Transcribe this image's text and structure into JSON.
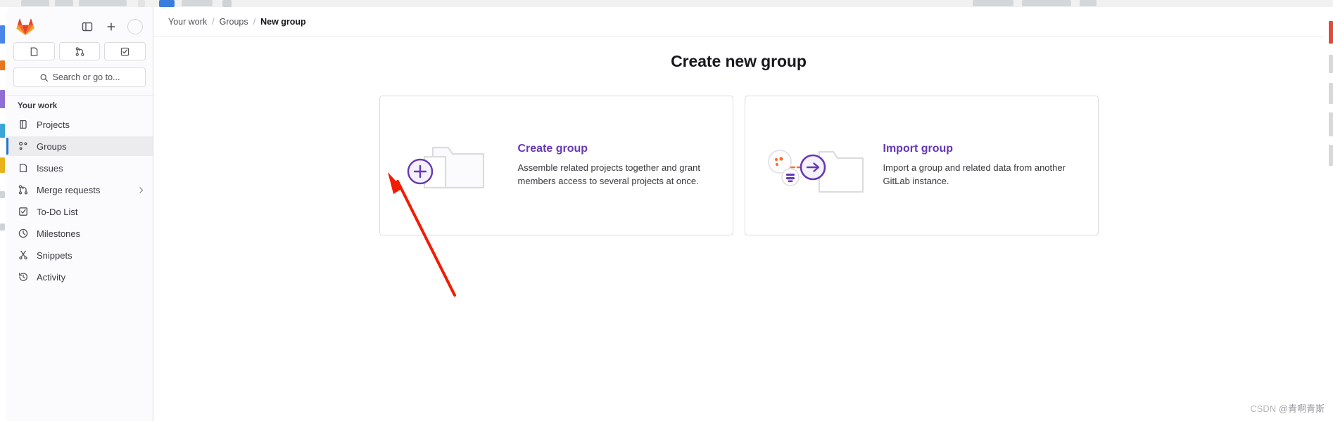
{
  "sidebar": {
    "logo_icon": "gitlab-tanuki-logo",
    "top_actions": [
      {
        "icon": "sidebar-toggle-icon",
        "name": "sidebar-toggle-button"
      },
      {
        "icon": "plus-icon",
        "name": "create-new-button"
      },
      {
        "icon": "avatar",
        "name": "user-avatar"
      }
    ],
    "quick_buttons": [
      {
        "icon": "issues-icon",
        "name": "quick-issues-button"
      },
      {
        "icon": "merge-request-icon",
        "name": "quick-merge-requests-button"
      },
      {
        "icon": "todo-check-icon",
        "name": "quick-todo-button"
      }
    ],
    "search": {
      "placeholder": "Search or go to...",
      "icon": "search-icon"
    },
    "section_title": "Your work",
    "items": [
      {
        "label": "Projects",
        "icon": "projects-icon",
        "active": false,
        "chevron": false
      },
      {
        "label": "Groups",
        "icon": "groups-icon",
        "active": true,
        "chevron": false
      },
      {
        "label": "Issues",
        "icon": "issues-icon",
        "active": false,
        "chevron": false
      },
      {
        "label": "Merge requests",
        "icon": "merge-request-icon",
        "active": false,
        "chevron": true
      },
      {
        "label": "To-Do List",
        "icon": "todo-check-icon",
        "active": false,
        "chevron": false
      },
      {
        "label": "Milestones",
        "icon": "clock-icon",
        "active": false,
        "chevron": false
      },
      {
        "label": "Snippets",
        "icon": "scissors-icon",
        "active": false,
        "chevron": false
      },
      {
        "label": "Activity",
        "icon": "history-icon",
        "active": false,
        "chevron": false
      }
    ]
  },
  "breadcrumb": {
    "items": [
      {
        "label": "Your work",
        "current": false
      },
      {
        "label": "Groups",
        "current": false
      },
      {
        "label": "New group",
        "current": true
      }
    ],
    "separator": "/"
  },
  "page": {
    "title": "Create new group",
    "cards": [
      {
        "title": "Create group",
        "description": "Assemble related projects together and grant members access to several projects at once.",
        "art": "folder-plus-illustration"
      },
      {
        "title": "Import group",
        "description": "Import a group and related data from another GitLab instance.",
        "art": "folder-import-illustration"
      }
    ]
  },
  "annotation": {
    "arrow": "red-pointer-arrow",
    "color": "#f01c00"
  },
  "watermark": {
    "brand": "CSDN",
    "author": "@青啊青斯"
  },
  "colors": {
    "accent_purple": "#6638b6",
    "active_bar_blue": "#1f75cb",
    "sidebar_bg": "#fbfafd",
    "border": "#dcdcde"
  }
}
